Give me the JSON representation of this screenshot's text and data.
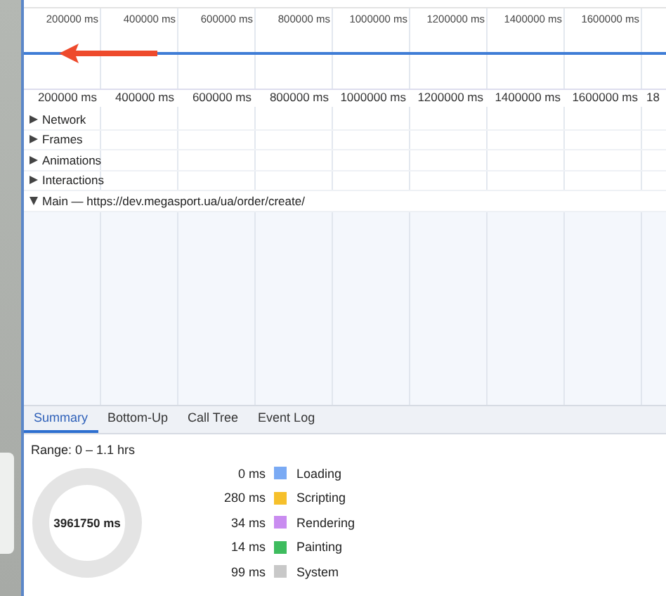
{
  "overview": {
    "ticks": [
      "200000 ms",
      "400000 ms",
      "600000 ms",
      "800000 ms",
      "1000000 ms",
      "1200000 ms",
      "1400000 ms",
      "1600000 ms"
    ]
  },
  "ruler": {
    "ticks": [
      "200000 ms",
      "400000 ms",
      "600000 ms",
      "800000 ms",
      "1000000 ms",
      "1200000 ms",
      "1400000 ms",
      "1600000 ms",
      "18"
    ]
  },
  "tracks": [
    {
      "label": "Network",
      "expanded": false
    },
    {
      "label": "Frames",
      "expanded": false
    },
    {
      "label": "Animations",
      "expanded": false
    },
    {
      "label": "Interactions",
      "expanded": false
    },
    {
      "label": "Main — https://dev.megasport.ua/ua/order/create/",
      "expanded": true
    }
  ],
  "tabs": [
    {
      "label": "Summary",
      "selected": true
    },
    {
      "label": "Bottom-Up",
      "selected": false
    },
    {
      "label": "Call Tree",
      "selected": false
    },
    {
      "label": "Event Log",
      "selected": false
    }
  ],
  "summary": {
    "range": "Range: 0 – 1.1 hrs",
    "total": "3961750 ms",
    "legend": [
      {
        "value": "0 ms",
        "label": "Loading",
        "color": "#7aaaf4"
      },
      {
        "value": "280 ms",
        "label": "Scripting",
        "color": "#f6c02b"
      },
      {
        "value": "34 ms",
        "label": "Rendering",
        "color": "#c98cf0"
      },
      {
        "value": "14 ms",
        "label": "Painting",
        "color": "#3ebc5e"
      },
      {
        "value": "99 ms",
        "label": "System",
        "color": "#c8c8c8"
      }
    ]
  }
}
